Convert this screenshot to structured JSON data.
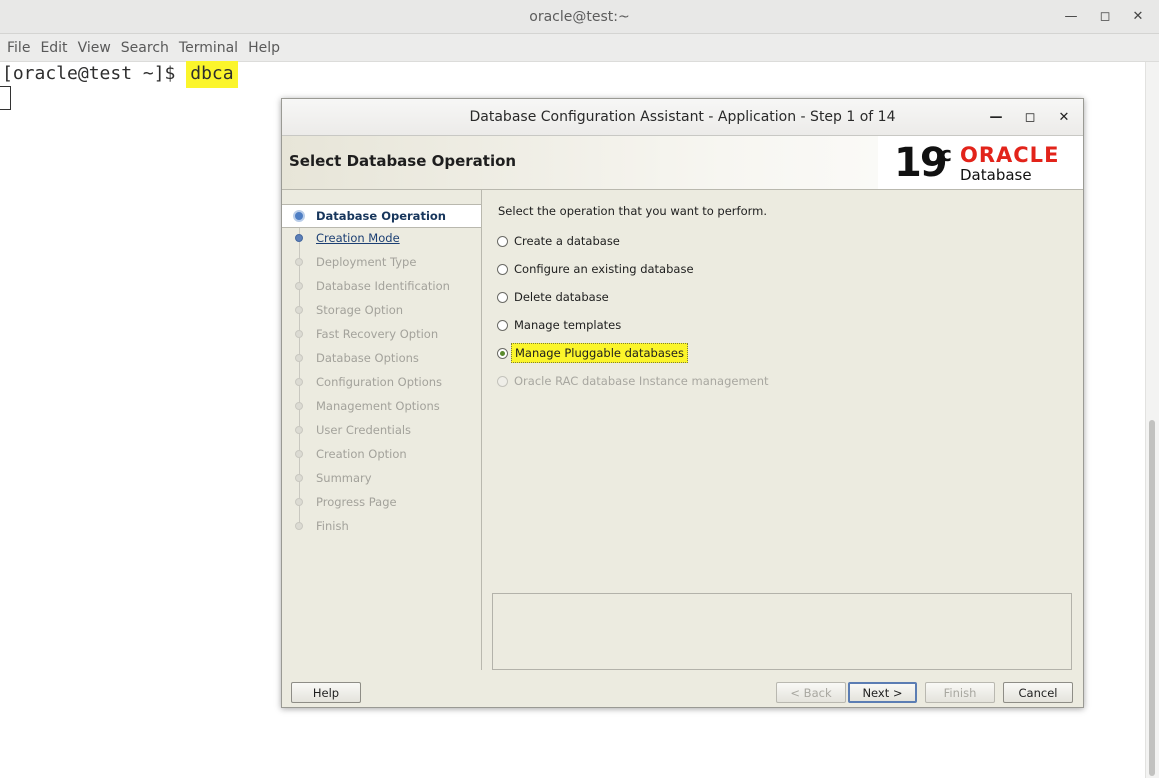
{
  "terminal": {
    "title": "oracle@test:~",
    "menu": [
      "File",
      "Edit",
      "View",
      "Search",
      "Terminal",
      "Help"
    ],
    "prompt": "[oracle@test ~]$ ",
    "command": "dbca",
    "controls": [
      "minimize-icon",
      "maximize-icon",
      "close-icon"
    ]
  },
  "dialog": {
    "title": "Database Configuration Assistant - Application - Step 1 of 14",
    "header_title": "Select Database Operation",
    "logo": {
      "version": "19",
      "sup": "c",
      "brand": "ORACLE",
      "product": "Database",
      "brand_color": "#e2231a"
    },
    "nav_items": [
      {
        "label": "Database Operation",
        "state": "current"
      },
      {
        "label": "Creation Mode",
        "state": "next"
      },
      {
        "label": "Deployment Type",
        "state": "disabled"
      },
      {
        "label": "Database Identification",
        "state": "disabled"
      },
      {
        "label": "Storage Option",
        "state": "disabled"
      },
      {
        "label": "Fast Recovery Option",
        "state": "disabled"
      },
      {
        "label": "Database Options",
        "state": "disabled"
      },
      {
        "label": "Configuration Options",
        "state": "disabled"
      },
      {
        "label": "Management Options",
        "state": "disabled"
      },
      {
        "label": "User Credentials",
        "state": "disabled"
      },
      {
        "label": "Creation Option",
        "state": "disabled"
      },
      {
        "label": "Summary",
        "state": "disabled"
      },
      {
        "label": "Progress Page",
        "state": "disabled"
      },
      {
        "label": "Finish",
        "state": "disabled"
      }
    ],
    "prompt": "Select the operation that you want to perform.",
    "options": [
      {
        "label": "Create a database",
        "selected": false,
        "enabled": true
      },
      {
        "label": "Configure an existing database",
        "selected": false,
        "enabled": true
      },
      {
        "label": "Delete database",
        "selected": false,
        "enabled": true
      },
      {
        "label": "Manage templates",
        "selected": false,
        "enabled": true
      },
      {
        "label": "Manage Pluggable databases",
        "selected": true,
        "enabled": true
      },
      {
        "label": "Oracle RAC database Instance management",
        "selected": false,
        "enabled": false
      }
    ],
    "buttons": {
      "help": "Help",
      "back": "< Back",
      "next": "Next >",
      "finish": "Finish",
      "cancel": "Cancel"
    }
  },
  "colors": {
    "highlight": "#fbf52b",
    "nav_current": "#17365c"
  }
}
